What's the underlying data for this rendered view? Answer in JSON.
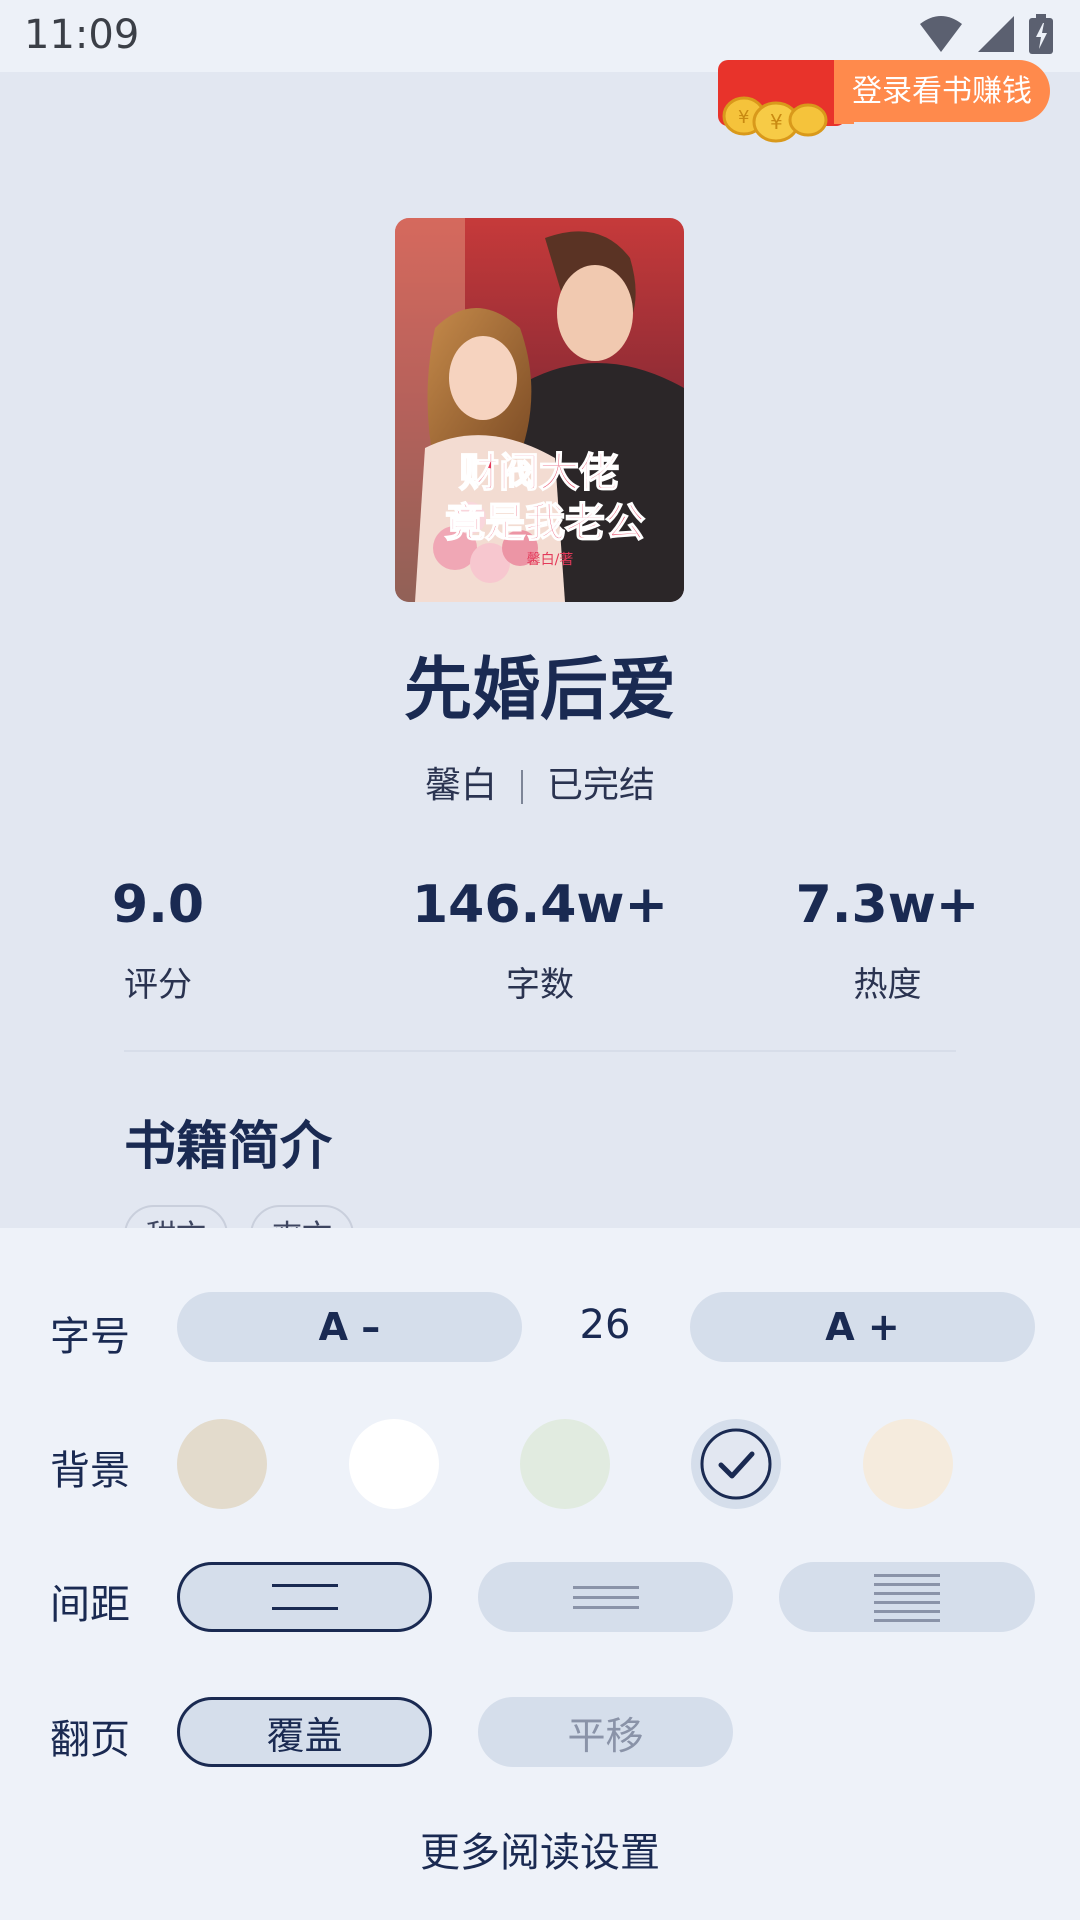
{
  "status_bar": {
    "time": "11:09"
  },
  "promo": {
    "label": "登录看书赚钱"
  },
  "book": {
    "cover_title": "财阀大佬竟是我老公",
    "cover_author": "馨白/著",
    "title": "先婚后爱",
    "author": "馨白",
    "status": "已完结"
  },
  "stats": [
    {
      "value": "9.0",
      "label": "评分"
    },
    {
      "value": "146.4w+",
      "label": "字数"
    },
    {
      "value": "7.3w+",
      "label": "热度"
    }
  ],
  "intro": {
    "title": "书籍简介",
    "tags": [
      "甜文",
      "爽文"
    ]
  },
  "settings": {
    "font_size": {
      "label": "字号",
      "decrease": "A –",
      "value": "26",
      "increase": "A +"
    },
    "background": {
      "label": "背景",
      "colors": [
        "#e3dbcc",
        "#ffffff",
        "#e1ebe0",
        "#e2e7f1",
        "#f5ebdd"
      ],
      "selected_index": 3
    },
    "spacing": {
      "label": "间距",
      "selected_index": 0
    },
    "page_turn": {
      "label": "翻页",
      "options": [
        "覆盖",
        "平移"
      ],
      "selected": "覆盖"
    },
    "more": "更多阅读设置"
  }
}
